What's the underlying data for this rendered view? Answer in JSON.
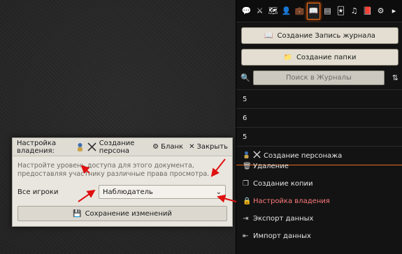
{
  "dialog": {
    "title": "Настройка владения:",
    "document_name": "Создание персона",
    "blank_label": "Бланк",
    "close_label": "Закрыть",
    "notes": "Настройте уровень доступа для этого документа, предоставляя участнику различные права просмотра.",
    "all_players_label": "Все игроки",
    "permission_value": "Наблюдатель",
    "save_label": "Сохранение изменений"
  },
  "sidebar": {
    "tabs": [
      {
        "icon": "chat-icon",
        "glyph": "💬"
      },
      {
        "icon": "combat-icon",
        "glyph": "⚔"
      },
      {
        "icon": "map-icon",
        "glyph": "🗺"
      },
      {
        "icon": "actor-icon",
        "glyph": "👤"
      },
      {
        "icon": "items-icon",
        "glyph": "💼"
      },
      {
        "icon": "journal-icon",
        "glyph": "📖",
        "active": true
      },
      {
        "icon": "table-icon",
        "glyph": "▤"
      },
      {
        "icon": "cards-icon",
        "glyph": "🃏"
      },
      {
        "icon": "music-icon",
        "glyph": "♫"
      },
      {
        "icon": "compendium-icon",
        "glyph": "📕"
      },
      {
        "icon": "settings-icon",
        "glyph": "⚙"
      },
      {
        "icon": "collapse-icon",
        "glyph": "▸"
      }
    ],
    "create_entry_label": "Создание Запись журнала",
    "create_folder_label": "Создание папки",
    "search_placeholder": "Поиск в Журналы",
    "entries": [
      "5",
      "6",
      "5"
    ],
    "highlighted_entry": "Создание персонажа"
  },
  "context_menu": {
    "items": [
      {
        "label": "Удаление",
        "icon": "trash-icon",
        "glyph": "🗑"
      },
      {
        "label": "Создание копии",
        "icon": "copy-icon",
        "glyph": "❐"
      },
      {
        "label": "Настройка владения",
        "icon": "lock-icon",
        "glyph": "🔒",
        "selected": true
      },
      {
        "label": "Экспорт данных",
        "icon": "export-icon",
        "glyph": "⇥"
      },
      {
        "label": "Импорт данных",
        "icon": "import-icon",
        "glyph": "⇤"
      }
    ]
  },
  "colors": {
    "accent": "#e36c1f",
    "highlight_text": "#ff7a7a",
    "arrow": "#e01010"
  }
}
